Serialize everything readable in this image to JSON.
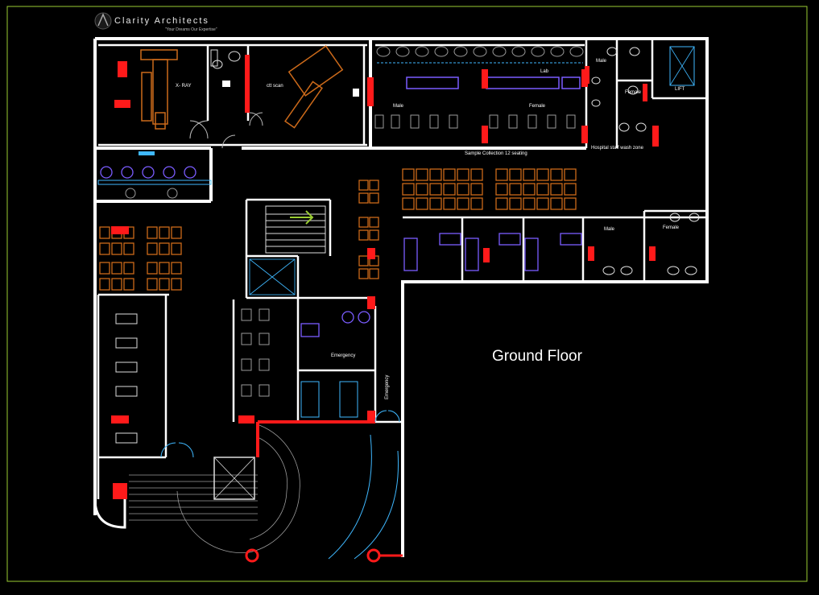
{
  "brand": {
    "name": "Clarity Architects",
    "tagline": "\"Your Dreams Our Expertise\""
  },
  "plan_title": "Ground Floor",
  "rooms": {
    "xray": "X- RAY",
    "ctscan": "ctt scan",
    "lab": "Lab",
    "male_top": "Male",
    "female_top": "Female",
    "lift": "LIFT",
    "male_toilet": "Male",
    "female_toilet": "Female",
    "sample": "Sample Collection 12 seating",
    "wash": "Hospital staff wash zone",
    "male_wc": "Male",
    "female_wc": "Female",
    "emergency_room": "Emergency",
    "emergency_side": "Emergency"
  },
  "colors": {
    "wall": "#ffffff",
    "border": "#9acd32",
    "red": "#ff1a1a",
    "orange": "#cc6a1a",
    "purple": "#7a5cff",
    "cyan": "#3fb8ff",
    "gray": "#9a9a9a"
  }
}
